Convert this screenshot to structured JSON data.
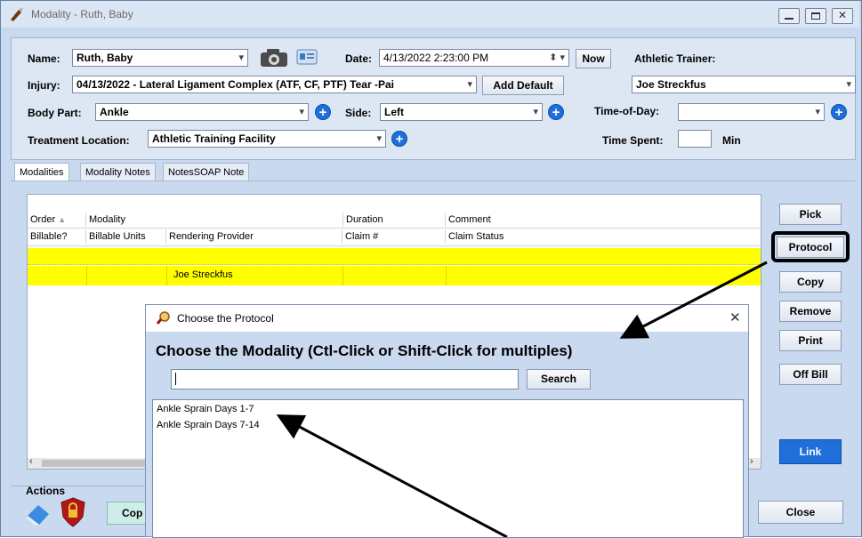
{
  "window": {
    "title": "Modality - Ruth, Baby"
  },
  "form": {
    "name_label": "Name:",
    "name_value": "Ruth, Baby",
    "date_label": "Date:",
    "date_value": "4/13/2022  2:23:00 PM",
    "now_label": "Now",
    "athletic_trainer_label": "Athletic Trainer:",
    "athletic_trainer_value": "Joe Streckfus",
    "injury_label": "Injury:",
    "injury_value": "04/13/2022 - Lateral Ligament Complex (ATF, CF, PTF) Tear -Pai",
    "add_default_label": "Add Default",
    "body_part_label": "Body Part:",
    "body_part_value": "Ankle",
    "side_label": "Side:",
    "side_value": "Left",
    "time_of_day_label": "Time-of-Day:",
    "time_of_day_value": "",
    "treatment_location_label": "Treatment Location:",
    "treatment_location_value": "Athletic Training Facility",
    "time_spent_label": "Time Spent:",
    "time_spent_value": "",
    "min_label": "Min"
  },
  "tabs": [
    {
      "label": "Modalities"
    },
    {
      "label": "Modality Notes"
    },
    {
      "label": "NotesSOAP Note"
    }
  ],
  "grid": {
    "header_row1": [
      "Order",
      "Modality",
      "Duration",
      "Comment"
    ],
    "header_row2": [
      "Billable?",
      "Billable Units",
      "Rendering Provider",
      "Claim #",
      "Claim Status"
    ],
    "row_provider": "Joe Streckfus"
  },
  "side_buttons": {
    "pick": "Pick",
    "protocol": "Protocol",
    "copy": "Copy",
    "remove": "Remove",
    "print": "Print",
    "off_bill": "Off Bill",
    "link": "Link",
    "close": "Close"
  },
  "actions": {
    "label": "Actions",
    "copy_button": "Cop"
  },
  "dialog": {
    "title": "Choose the Protocol",
    "heading": "Choose the Modality (Ctl-Click or Shift-Click for multiples)",
    "search_value": "",
    "search_label": "Search",
    "items": [
      "Ankle Sprain Days 1-7",
      "Ankle Sprain Days 7-14"
    ]
  },
  "colors": {
    "highlight_row": "#ffff00",
    "accent": "#1e6fd9",
    "window_bg": "#c9d9ef"
  }
}
